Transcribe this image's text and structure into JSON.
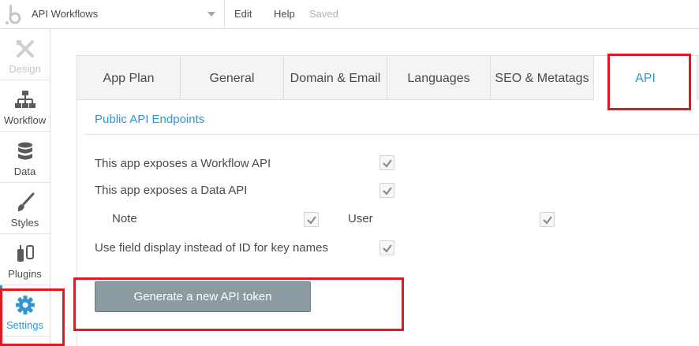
{
  "topbar": {
    "app_name": "API Workflows",
    "menu_edit": "Edit",
    "menu_help": "Help",
    "status": "Saved",
    "logo_icon": "bubble-logo-icon",
    "dropdown_icon": "caret-down-icon"
  },
  "sidebar": {
    "items": [
      {
        "label": "Design",
        "icon": "design-tools-icon",
        "state": "disabled"
      },
      {
        "label": "Workflow",
        "icon": "workflow-tree-icon",
        "state": "normal"
      },
      {
        "label": "Data",
        "icon": "database-icon",
        "state": "normal"
      },
      {
        "label": "Styles",
        "icon": "paint-brush-icon",
        "state": "normal"
      },
      {
        "label": "Plugins",
        "icon": "plug-icon",
        "state": "normal"
      },
      {
        "label": "Settings",
        "icon": "gear-icon",
        "state": "active"
      }
    ]
  },
  "tabs": [
    {
      "label": "App Plan",
      "active": false
    },
    {
      "label": "General",
      "active": false
    },
    {
      "label": "Domain & Email",
      "active": false
    },
    {
      "label": "Languages",
      "active": false
    },
    {
      "label": "SEO & Metatags",
      "active": false
    },
    {
      "label": "API",
      "active": true
    }
  ],
  "api": {
    "section_title": "Public API Endpoints",
    "workflow_api_label": "This app exposes a Workflow API",
    "workflow_api_checked": true,
    "data_api_label": "This app exposes a Data API",
    "data_api_checked": true,
    "data_types": [
      {
        "label": "Note",
        "checked": true
      },
      {
        "label": "User",
        "checked": true
      }
    ],
    "field_display_label": "Use field display instead of ID for key names",
    "field_display_checked": true,
    "generate_button": "Generate a new API token"
  },
  "colors": {
    "accent": "#2f96d1",
    "button_bg": "#8c9ba1",
    "annotation": "#e8141e"
  }
}
